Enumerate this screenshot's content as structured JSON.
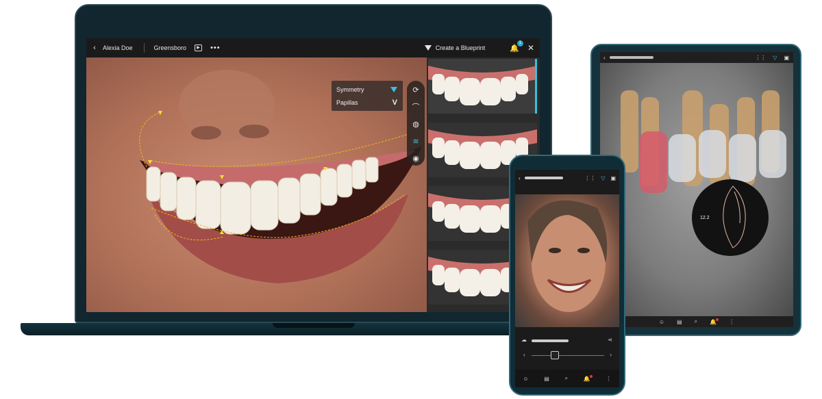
{
  "laptop": {
    "topbar": {
      "back_icon": "chevron-left-icon",
      "patient_name": "Alexia Doe",
      "clinic_name": "Greensboro",
      "play_icon": "play-icon",
      "more_icon": "more-horizontal-icon",
      "blueprint_label": "Create a Blueprint",
      "notification_icon": "bell-icon",
      "notification_count": "1",
      "close_icon": "close-icon"
    },
    "guides_panel": {
      "items": [
        {
          "label": "Symmetry",
          "icon": "triangle-down-icon"
        },
        {
          "label": "Papillas",
          "icon": "v-icon",
          "glyph": "V"
        }
      ]
    },
    "tool_rail": {
      "tools": [
        {
          "icon": "rotate-icon",
          "glyph": "⟳"
        },
        {
          "icon": "lip-line-icon",
          "glyph": "⌒"
        },
        {
          "icon": "color-palette-icon",
          "glyph": "◍"
        },
        {
          "icon": "arch-icon",
          "glyph": "≋",
          "active": true
        },
        {
          "icon": "eye-icon",
          "glyph": "◉"
        }
      ]
    },
    "thumbnails": {
      "count": 4,
      "selected": 1
    },
    "colors": {
      "accent": "#36c1de",
      "guide_line": "#f2b817"
    }
  },
  "tablet": {
    "toolbar_icons": [
      "chevron-left-icon",
      "grid-icon",
      "filter-icon",
      "layers-icon"
    ],
    "measurement": "12.2",
    "bottom_icons": [
      "profile-icon",
      "folder-icon",
      "search-icon",
      "bell-icon",
      "more-vertical-icon"
    ]
  },
  "phone": {
    "toolbar_icons": [
      "chevron-left-icon",
      "grid-icon",
      "filter-icon",
      "layers-icon"
    ],
    "controls": {
      "upload_icon": "cloud-upload-icon",
      "share_icon": "share-icon",
      "prev_icon": "chevron-left-icon",
      "next_icon": "chevron-right-icon"
    },
    "bottom_icons": [
      "profile-icon",
      "folder-icon",
      "search-icon",
      "bell-icon",
      "more-vertical-icon"
    ]
  }
}
